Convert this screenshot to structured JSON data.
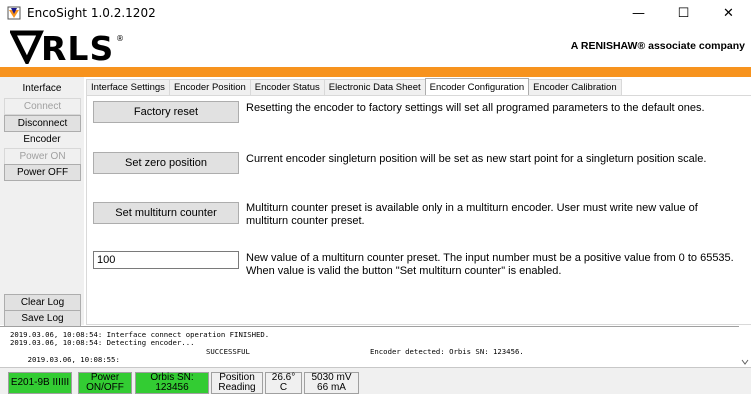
{
  "window": {
    "title": "EncoSight 1.0.2.1202",
    "minimize": "—",
    "maximize": "☐",
    "close": "✕"
  },
  "header": {
    "logo_text": "RLS",
    "logo_registered": "®",
    "tagline": "A RENISHAW® associate company"
  },
  "left_panel": {
    "interface_label": "Interface",
    "connect": "Connect",
    "disconnect": "Disconnect",
    "encoder_label": "Encoder",
    "power_on": "Power ON",
    "power_off": "Power OFF",
    "clear_log": "Clear Log",
    "save_log": "Save Log"
  },
  "tabs": [
    {
      "label": "Interface Settings"
    },
    {
      "label": "Encoder Position"
    },
    {
      "label": "Encoder Status"
    },
    {
      "label": "Electronic Data Sheet"
    },
    {
      "label": "Encoder Configuration"
    },
    {
      "label": "Encoder Calibration"
    }
  ],
  "config": {
    "factory_reset_label": "Factory reset",
    "factory_reset_desc": "Resetting the encoder to factory settings will set all programed parameters to the default ones.",
    "set_zero_label": "Set zero position",
    "set_zero_desc": "Current encoder singleturn position will be set as new start point for a singleturn position scale.",
    "set_multiturn_label": "Set multiturn counter",
    "set_multiturn_desc": "Multiturn counter preset is available only in a multiturn encoder. User must write new value of multiturn counter preset.",
    "preset_value": "100",
    "preset_desc": "New value of a multiturn counter preset. The input number must be a positive value from 0 to 65535. When value is valid the button \"Set multiturn counter\" is enabled."
  },
  "log": {
    "lines": [
      "2019.03.06, 10:08:54: Interface connect operation FINISHED.",
      "2019.03.06, 10:08:54: Detecting encoder...",
      "2019.03.06, 10:08:55:"
    ],
    "line3_status": "SUCCESSFUL",
    "line3_detail": "Encoder detected: Orbis SN: 123456."
  },
  "status_bar": {
    "interface": "E201-9B IIIIII",
    "power_line1": "Power",
    "power_line2": "ON/OFF",
    "encoder_line1": "Orbis SN:",
    "encoder_line2": "123456",
    "position_line1": "Position",
    "position_line2": "Reading",
    "temp_line1": "26.6°",
    "temp_line2": "C",
    "supply_line1": "5030 mV",
    "supply_line2": "66 mA"
  },
  "colors": {
    "accent_orange": "#f7931e",
    "status_green": "#33cc33"
  }
}
